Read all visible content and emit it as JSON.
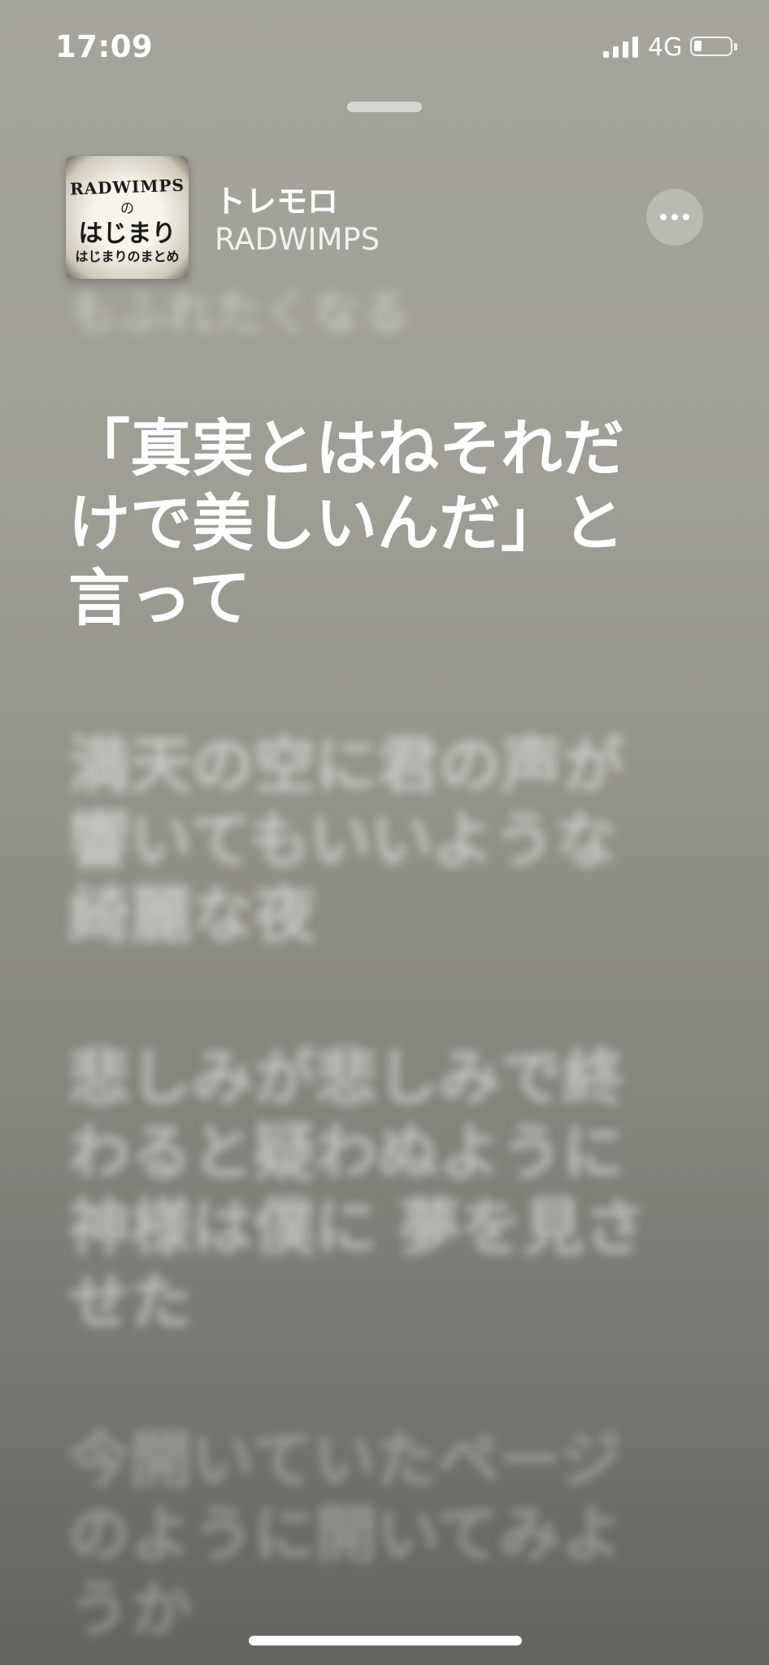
{
  "status_bar": {
    "time": "17:09",
    "network": "4G",
    "signal_bars": 4,
    "battery_level": 0.15
  },
  "now_playing": {
    "song_title": "トレモロ",
    "artist": "RADWIMPS",
    "album_art": {
      "line1": "RADWIMPS",
      "line2": "の",
      "line3": "はじまり",
      "line4": "はじまりのまとめ"
    },
    "more_icon": "ellipsis-icon"
  },
  "lyrics": {
    "previous": "もふれたくなる",
    "current": "「真実とはねそれだけで美しいんだ」と言って",
    "next": [
      "満天の空に君の声が響いてもいいような綺麗な夜",
      "悲しみが悲しみで終わると疑わぬように神様は僕に 夢を見させた",
      "今開いていたページのように開いてみようか"
    ]
  },
  "colors": {
    "background_top": "#a6a59c",
    "background_bottom": "#64635f",
    "text": "#ffffff"
  }
}
